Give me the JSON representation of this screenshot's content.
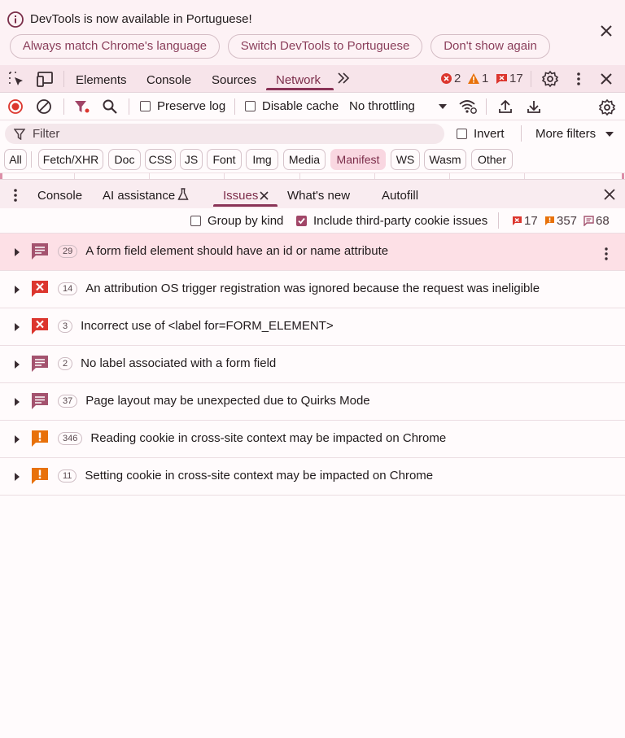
{
  "infobar": {
    "message": "DevTools is now available in Portuguese!",
    "buttons": [
      "Always match Chrome's language",
      "Switch DevTools to Portuguese",
      "Don't show again"
    ]
  },
  "main_tabs": {
    "items": [
      "Elements",
      "Console",
      "Sources",
      "Network"
    ],
    "active": "Network",
    "error_count": "2",
    "warning_count": "1",
    "issue_count": "17"
  },
  "network_toolbar": {
    "preserve_log": "Preserve log",
    "disable_cache": "Disable cache",
    "throttling": "No throttling"
  },
  "filter": {
    "placeholder": "Filter",
    "invert": "Invert",
    "more_filters": "More filters"
  },
  "type_filters": [
    "All",
    "Fetch/XHR",
    "Doc",
    "CSS",
    "JS",
    "Font",
    "Img",
    "Media",
    "Manifest",
    "WS",
    "Wasm",
    "Other"
  ],
  "active_type_filter": "Manifest",
  "drawer": {
    "tabs": [
      "Console",
      "AI assistance",
      "Issues",
      "What's new",
      "Autofill"
    ],
    "active": "Issues"
  },
  "issues_toolbar": {
    "group_by_kind": "Group by kind",
    "include_third_party": "Include third-party cookie issues",
    "errors": "17",
    "warnings": "357",
    "info": "68"
  },
  "issues": [
    {
      "kind": "improvement",
      "count": "29",
      "title": "A form field element should have an id or name attribute"
    },
    {
      "kind": "error",
      "count": "14",
      "title": "An attribution OS trigger registration was ignored because the request was ineligible"
    },
    {
      "kind": "error",
      "count": "3",
      "title": "Incorrect use of <label for=FORM_ELEMENT>"
    },
    {
      "kind": "improvement",
      "count": "2",
      "title": "No label associated with a form field"
    },
    {
      "kind": "improvement",
      "count": "37",
      "title": "Page layout may be unexpected due to Quirks Mode"
    },
    {
      "kind": "warning",
      "count": "346",
      "title": "Reading cookie in cross-site context may be impacted on Chrome"
    },
    {
      "kind": "warning",
      "count": "11",
      "title": "Setting cookie in cross-site context may be impacted on Chrome"
    }
  ],
  "colors": {
    "accent": "#8a3457",
    "error": "#dc362e",
    "warning": "#e8710a",
    "improvement": "#a4536f"
  }
}
